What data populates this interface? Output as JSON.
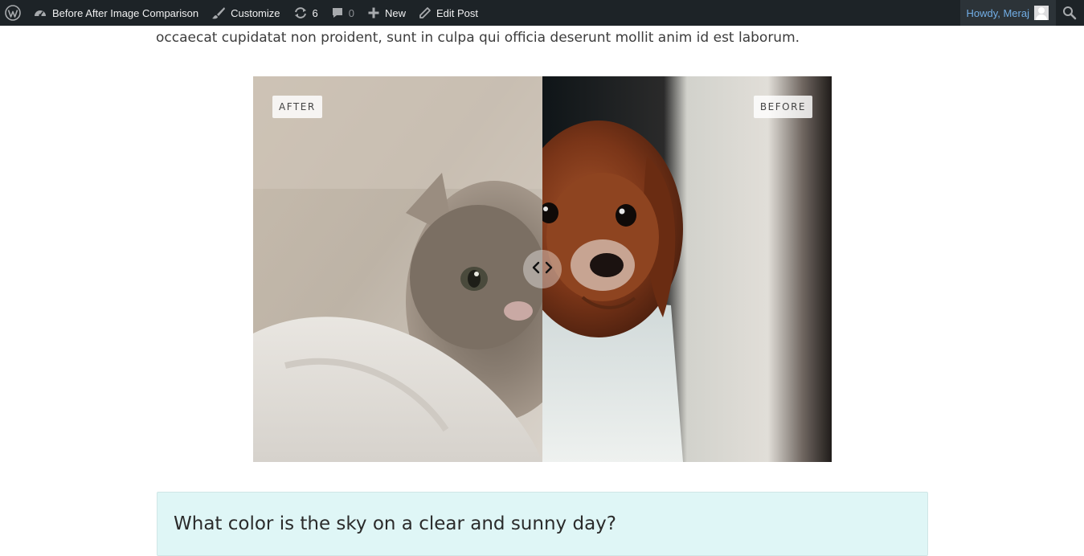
{
  "adminbar": {
    "site_title": "Before After Image Comparison",
    "customize": "Customize",
    "updates_count": "6",
    "comments_count": "0",
    "new_label": "New",
    "edit_post": "Edit Post",
    "howdy": "Howdy, Meraj",
    "icons": [
      "wordpress-logo-icon",
      "dashboard-icon",
      "brush-icon",
      "updates-icon",
      "comment-icon",
      "plus-icon",
      "pencil-icon",
      "avatar",
      "search-icon"
    ]
  },
  "content": {
    "intro_text": "occaecat cupidatat non proident, sunt in culpa qui officia deserunt mollit anim id est laborum."
  },
  "comparison": {
    "after_label": "AFTER",
    "before_label": "BEFORE",
    "divider_position": 0.5,
    "left_image": "kitten",
    "right_image": "dog"
  },
  "quiz": {
    "question": "What color is the sky on a clear and sunny day?"
  },
  "colors": {
    "adminbar_bg": "#1d2327",
    "adminbar_text": "#f0f0f1",
    "account_link": "#72aee6",
    "quiz_bg": "#dff6f6"
  }
}
